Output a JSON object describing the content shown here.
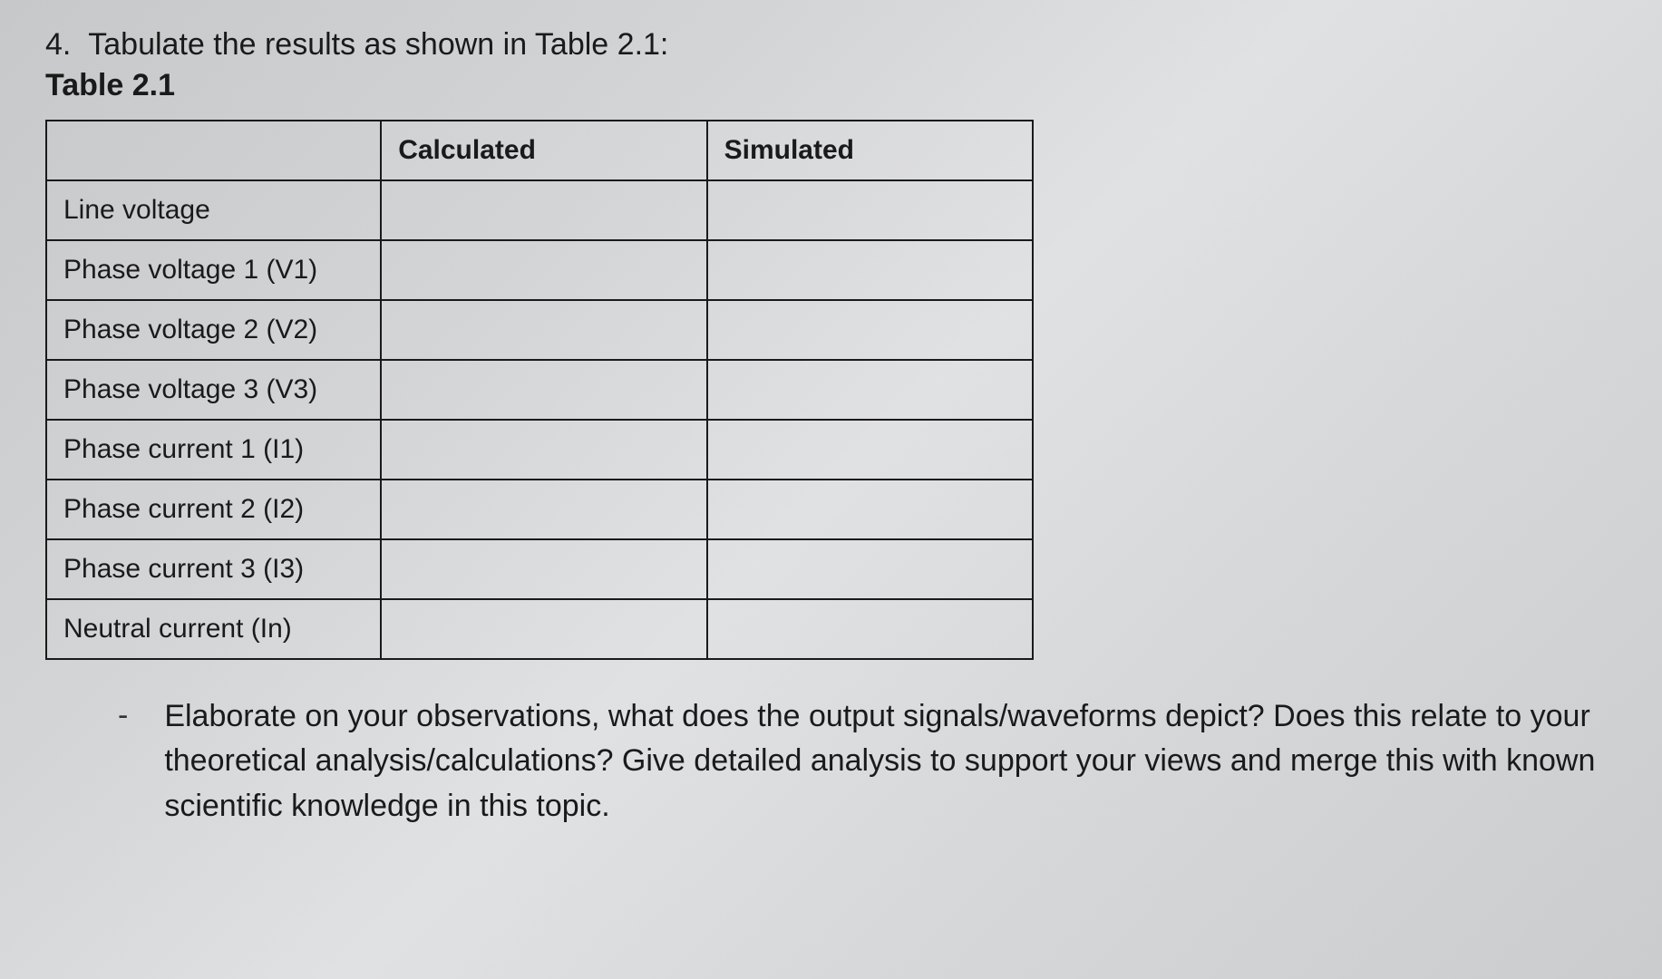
{
  "heading": {
    "number": "4.",
    "instruction": "Tabulate the results as shown in Table 2.1:",
    "caption": "Table 2.1"
  },
  "table": {
    "headers": {
      "param": "",
      "calculated": "Calculated",
      "simulated": "Simulated"
    },
    "rows": [
      {
        "label": "Line voltage",
        "calculated": "",
        "simulated": ""
      },
      {
        "label": "Phase voltage 1 (V1)",
        "calculated": "",
        "simulated": ""
      },
      {
        "label": "Phase voltage 2 (V2)",
        "calculated": "",
        "simulated": ""
      },
      {
        "label": "Phase voltage 3 (V3)",
        "calculated": "",
        "simulated": ""
      },
      {
        "label": "Phase current 1 (I1)",
        "calculated": "",
        "simulated": ""
      },
      {
        "label": "Phase current 2 (I2)",
        "calculated": "",
        "simulated": ""
      },
      {
        "label": "Phase current 3 (I3)",
        "calculated": "",
        "simulated": ""
      },
      {
        "label": "Neutral current (In)",
        "calculated": "",
        "simulated": ""
      }
    ]
  },
  "bullet": {
    "dash": "-",
    "text": "Elaborate on your observations, what does the output signals/waveforms depict? Does this relate to your theoretical analysis/calculations? Give detailed analysis to support your views and merge this with known scientific knowledge in this topic."
  }
}
